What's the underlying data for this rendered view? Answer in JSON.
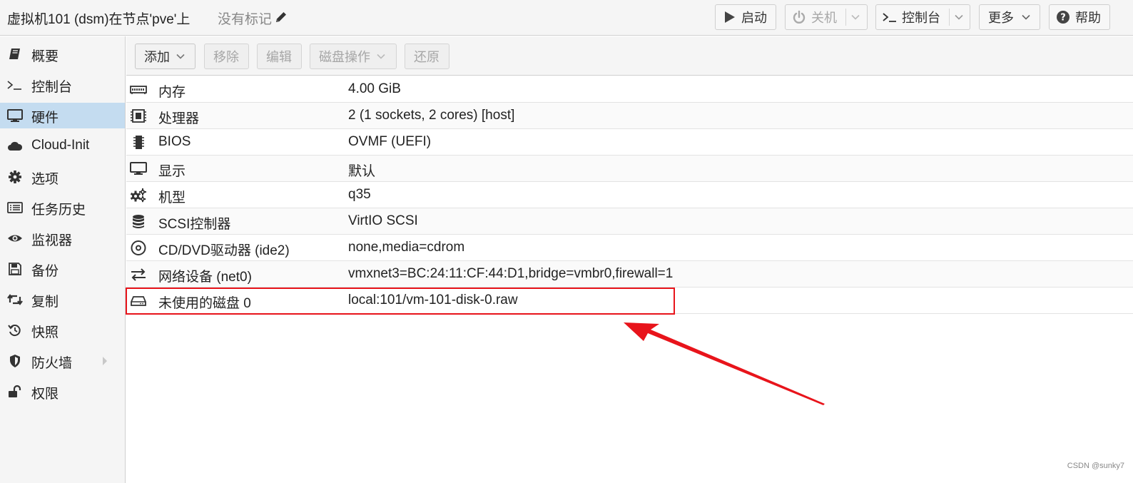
{
  "header": {
    "title": "虚拟机101 (dsm)在节点'pve'上",
    "tags_label": "没有标记",
    "buttons": {
      "start": "启动",
      "shutdown": "关机",
      "console": "控制台",
      "more": "更多",
      "help": "帮助"
    }
  },
  "sidebar": {
    "items": [
      {
        "label": "概要",
        "icon": "book-icon"
      },
      {
        "label": "控制台",
        "icon": "terminal-icon"
      },
      {
        "label": "硬件",
        "icon": "monitor-icon",
        "active": true
      },
      {
        "label": "Cloud-Init",
        "icon": "cloud-icon"
      },
      {
        "label": "选项",
        "icon": "gear-icon"
      },
      {
        "label": "任务历史",
        "icon": "list-icon"
      },
      {
        "label": "监视器",
        "icon": "eye-icon"
      },
      {
        "label": "备份",
        "icon": "floppy-icon"
      },
      {
        "label": "复制",
        "icon": "retweet-icon"
      },
      {
        "label": "快照",
        "icon": "history-icon"
      },
      {
        "label": "防火墙",
        "icon": "shield-icon"
      },
      {
        "label": "权限",
        "icon": "unlock-icon"
      }
    ]
  },
  "toolbar": {
    "add": "添加",
    "remove": "移除",
    "edit": "编辑",
    "disk_action": "磁盘操作",
    "revert": "还原"
  },
  "hardware": {
    "rows": [
      {
        "name": "内存",
        "value": "4.00 GiB",
        "icon": "memory-icon"
      },
      {
        "name": "处理器",
        "value": "2 (1 sockets, 2 cores) [host]",
        "icon": "cpu-icon"
      },
      {
        "name": "BIOS",
        "value": "OVMF (UEFI)",
        "icon": "microchip-icon"
      },
      {
        "name": "显示",
        "value": "默认",
        "icon": "desktop-icon"
      },
      {
        "name": "机型",
        "value": "q35",
        "icon": "cogs-icon"
      },
      {
        "name": "SCSI控制器",
        "value": "VirtIO SCSI",
        "icon": "database-icon"
      },
      {
        "name": "CD/DVD驱动器 (ide2)",
        "value": "none,media=cdrom",
        "icon": "cdrom-icon"
      },
      {
        "name": "网络设备 (net0)",
        "value": "vmxnet3=BC:24:11:CF:44:D1,bridge=vmbr0,firewall=1",
        "icon": "exchange-icon"
      },
      {
        "name": "未使用的磁盘 0",
        "value": "local:101/vm-101-disk-0.raw",
        "icon": "hdd-icon"
      }
    ]
  },
  "annotation": {
    "color": "#e8141b"
  },
  "watermark": "CSDN @sunky7",
  "colors": {
    "active_nav": "#c4dcf0",
    "accent": "#e8141b"
  }
}
